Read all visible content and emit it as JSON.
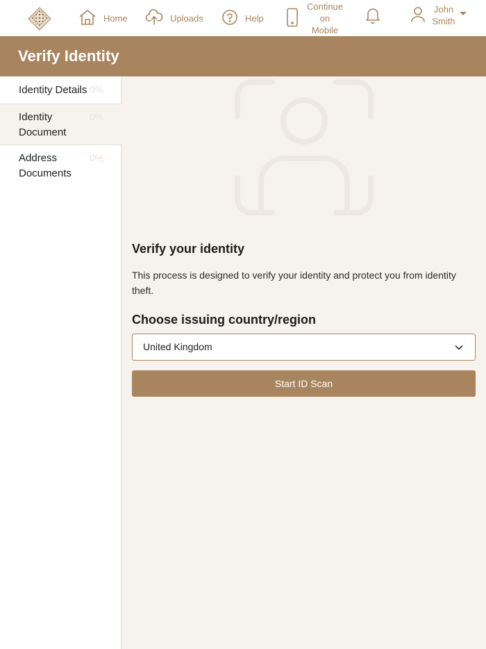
{
  "nav": {
    "home": "Home",
    "uploads": "Uploads",
    "help": "Help",
    "mobile_line1": "Continue",
    "mobile_line2": "on",
    "mobile_line3": "Mobile",
    "user_first": "John",
    "user_last": "Smith"
  },
  "page_title": "Verify Identity",
  "sidebar": {
    "items": [
      {
        "label": "Identity Details",
        "percent": "0%"
      },
      {
        "label": "Identity Document",
        "percent": "0%"
      },
      {
        "label": "Address Documents",
        "percent": "0%"
      }
    ]
  },
  "main": {
    "heading": "Verify your identity",
    "description": "This process is designed to verify your identity and protect you from identity theft.",
    "country_heading": "Choose issuing country/region",
    "country_value": "United Kingdom",
    "start_button": "Start ID Scan"
  },
  "colors": {
    "accent": "#a8855f",
    "background": "#f6f3ee"
  }
}
